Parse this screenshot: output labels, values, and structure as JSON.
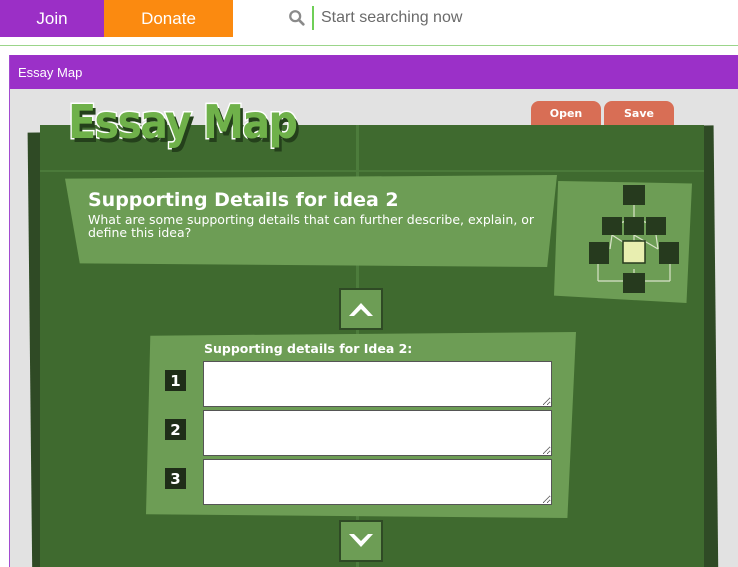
{
  "topbar": {
    "join_label": "Join",
    "donate_label": "Donate",
    "search_placeholder": "Start searching now"
  },
  "frame": {
    "header_title": "Essay Map"
  },
  "app": {
    "logo_text": "Essay Map",
    "open_label": "Open",
    "save_label": "Save",
    "heading_title": "Supporting Details for idea 2",
    "heading_subtitle": "What are some supporting details that can further describe, explain, or define this idea?",
    "form_label": "Supporting details for Idea 2:",
    "fields": [
      {
        "number": "1",
        "value": ""
      },
      {
        "number": "2",
        "value": ""
      },
      {
        "number": "3",
        "value": ""
      }
    ],
    "map_highlight_node": "idea-2-detail",
    "icons": [
      "search-icon",
      "arrow-up-icon",
      "arrow-down-icon",
      "essay-map-diagram-icon"
    ]
  },
  "colors": {
    "join": "#9b2fc6",
    "donate": "#fb8a10",
    "frame_header": "#9b30c8",
    "board": "#3f6a2f",
    "panel": "#6d9d55",
    "tab": "#d86e55",
    "highlight": "#e8eeb0"
  }
}
